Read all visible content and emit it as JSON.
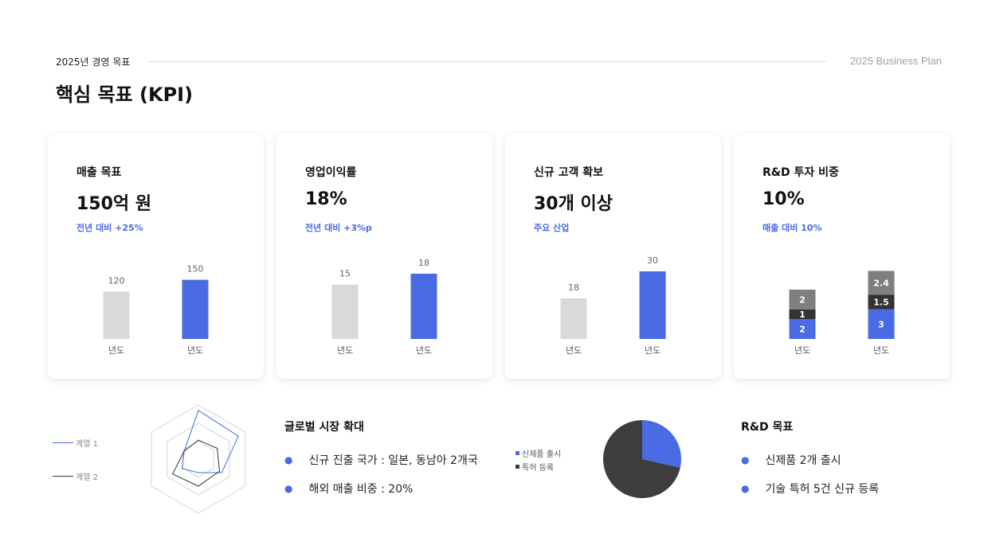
{
  "header": {
    "label": "2025년 경영 목표",
    "right": "2025 Business Plan",
    "title": "핵심 목표 (KPI)"
  },
  "cards": [
    {
      "title": "매출 목표",
      "value": "150억 원",
      "sub": "전년 대비 +25%"
    },
    {
      "title": "영업이익률",
      "value": "18%",
      "sub": "전년 대비 +3%p"
    },
    {
      "title": "신규 고객 확보",
      "value": "30개 이상",
      "sub": "주요 산업"
    },
    {
      "title": "R&D 투자 비중",
      "value": "10%",
      "sub": "매출 대비 10%"
    }
  ],
  "chart_data": [
    {
      "type": "bar",
      "categories": [
        "년도",
        "년도"
      ],
      "values": [
        120,
        150
      ],
      "colors": [
        "#d9d9d9",
        "#4a6be3"
      ],
      "ylim": [
        0,
        150
      ]
    },
    {
      "type": "bar",
      "categories": [
        "년도",
        "년도"
      ],
      "values": [
        15,
        18
      ],
      "colors": [
        "#d9d9d9",
        "#4a6be3"
      ],
      "ylim": [
        0,
        18
      ]
    },
    {
      "type": "bar",
      "categories": [
        "년도",
        "년도"
      ],
      "values": [
        18,
        30
      ],
      "colors": [
        "#d9d9d9",
        "#4a6be3"
      ],
      "ylim": [
        0,
        30
      ]
    },
    {
      "type": "bar",
      "stacked": true,
      "categories": [
        "년도",
        "년도"
      ],
      "series": [
        {
          "values": [
            2,
            3
          ],
          "color": "#4a6be3"
        },
        {
          "values": [
            1,
            1.5
          ],
          "color": "#333333"
        },
        {
          "values": [
            2,
            2.4
          ],
          "color": "#7f7f7f"
        }
      ]
    },
    {
      "type": "radar",
      "axes": 6,
      "series": [
        {
          "name": "계열 1",
          "values": [
            0.9,
            0.85,
            0.5,
            0.25,
            0.35,
            0.3
          ],
          "color": "#4a6be3"
        },
        {
          "name": "계열 2",
          "values": [
            0.35,
            0.4,
            0.45,
            0.5,
            0.55,
            0.3
          ],
          "color": "#333333"
        }
      ]
    },
    {
      "type": "pie",
      "series": [
        {
          "name": "신제품 출시",
          "value": 2,
          "color": "#4a6be3"
        },
        {
          "name": "특허 등록",
          "value": 5,
          "color": "#3d3d3d"
        }
      ]
    }
  ],
  "global": {
    "title": "글로벌 시장 확대",
    "bullets": [
      "신규 진출 국가 : 일본, 동남아 2개국",
      "해외 매출 비중 : 20%"
    ]
  },
  "rnd": {
    "title": "R&D 목표",
    "bullets": [
      "신제품 2개 출시",
      "기술 특허 5건 신규 등록"
    ]
  }
}
